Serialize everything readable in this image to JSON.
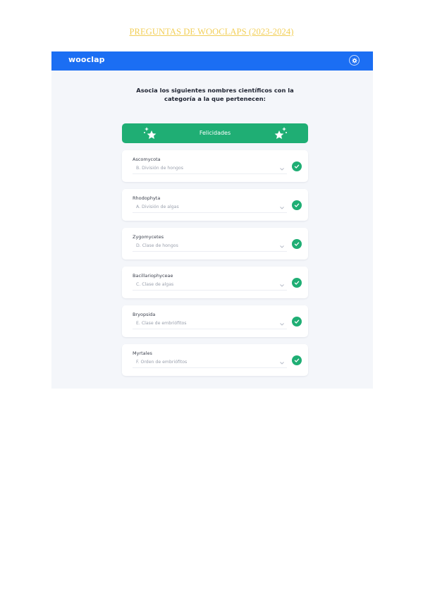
{
  "document": {
    "title": "PREGUNTAS DE WOOCLAPS (2023-2024)"
  },
  "app": {
    "logo": "wooclap",
    "settings_icon": "gear-icon",
    "accent_color": "#1b6ef3",
    "success_color": "#1fae74"
  },
  "question": {
    "line1": "Asocia los siguientes nombres científicos con la",
    "line2": "categoría a la que pertenecen:"
  },
  "banner": {
    "text": "Felicidades",
    "icons": [
      "sparkle-star-icon",
      "sparkle-star-icon"
    ]
  },
  "matches": [
    {
      "term": "Ascomycota",
      "answer": "B. División de hongos",
      "status": "correct"
    },
    {
      "term": "Rhodophyta",
      "answer": "A. División de algas",
      "status": "correct"
    },
    {
      "term": "Zygomycetes",
      "answer": "D. Clase de hongos",
      "status": "correct"
    },
    {
      "term": "Bacillariophyceae",
      "answer": "C. Clase de algas",
      "status": "correct"
    },
    {
      "term": "Bryopsida",
      "answer": "E. Clase de embriófitos",
      "status": "correct"
    },
    {
      "term": "Myrtales",
      "answer": "F. Orden de embriófitos",
      "status": "correct"
    }
  ]
}
